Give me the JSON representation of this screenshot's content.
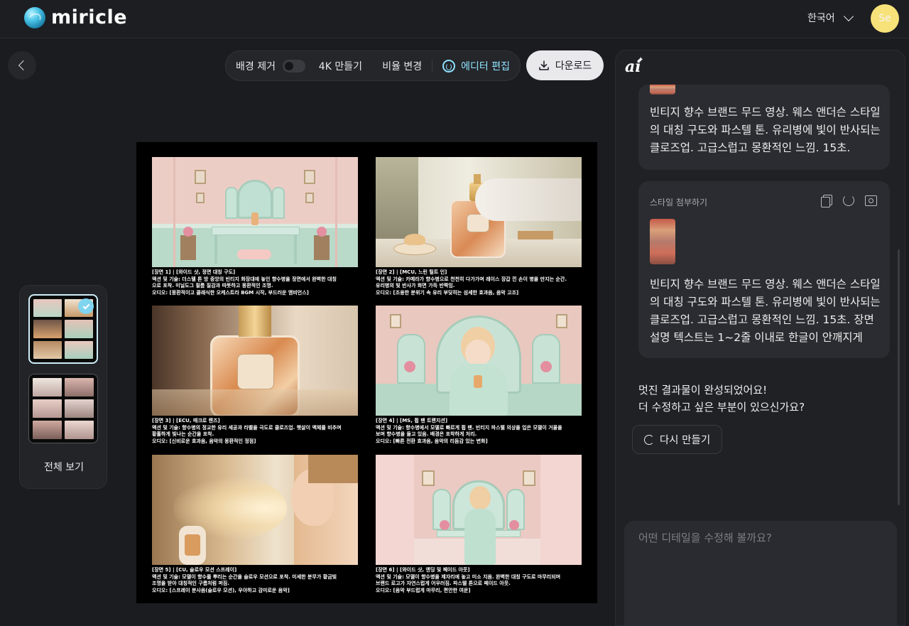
{
  "header": {
    "logo_text": "miricle",
    "language": "한국어",
    "avatar_initials": "Se"
  },
  "toolbar": {
    "remove_bg_label": "배경 제거",
    "remove_bg_on": false,
    "make_4k_label": "4K 만들기",
    "ratio_label": "비율 변경",
    "editor_label": "에디터 편집",
    "download_label": "다운로드"
  },
  "thumbnails": {
    "view_all_label": "전체 보기",
    "selected_index": 0
  },
  "storyboard": {
    "scenes": [
      {
        "lines": [
          "[장면 1] | [와이드 샷, 정면 대칭 구도]",
          "액션 및 기술: 더스텔 톤 방 중앙의 빈티지 화장대에 놓인 향수병을 정면에서 완벽한 대칭",
          "으로 포착. 미닐도그 필름 질감과 따뜻하고 몽환적인 조명.",
          "오디오: [몽환적이고 클래식한 오케스트라 BGM 시작, 부드러운 앰비언스]"
        ]
      },
      {
        "lines": [
          "[장면 2] | [MCU, 느린 틸트 인]",
          "액션 및 기술: 카메라가 향수병으로 천천히 다가가며 레이스 장갑 낀 손이 병을 만지는 순간.",
          "유리병의 빛 반사가 화면 가득 반짝임.",
          "오디오: [조용한 분위기 속 유리 부딪히는 섬세한 효과음, 음악 고조]"
        ]
      },
      {
        "lines": [
          "[장면 3] | [ECU, 매크로 렌즈]",
          "액션 및 기술: 향수병의 정교한 유리 세공과 라벨을 극도로 클로즈업. 햇살이 액체를 비추며",
          "황홀하게 빛나는 순간을 포착.",
          "오디오: [신비로운 효과음, 음악의 몽환적인 정점]"
        ]
      },
      {
        "lines": [
          "[장면 4] | [MS, 휩 팬 트랜지션]",
          "액션 및 기술: 향수병에서 모델로 빠르게 휩 팬. 빈티지 파스텔 의상을 입은 모델이 거울을",
          "보며 향수병을 들고 있음. 배경은 포착하게 처리.",
          "오디오: [빠른 전환 효과음, 음악의 리듬감 있는 변화]"
        ]
      },
      {
        "lines": [
          "[장면 5] | [CU, 슬로우 모션 스프레이]",
          "액션 및 기술: 모델이 향수를 뿌리는 순간을 슬로우 모션으로 포착. 미세한 분무가 황금빛",
          "조명을 받아 대칭적인 구름처럼 퍼짐.",
          "오디오: [스프레이 분사음(슬로우 모션), 우아하고 감미로운 음악]"
        ]
      },
      {
        "lines": [
          "[장면 6] | [와이드 샷, 엔딩 및 페이드 아웃]",
          "액션 및 기술: 모델이 향수병을 제자리에 놓고 미소 지음. 완벽한 대칭 구도로 마무리되며",
          "브랜드 로고가 자연스럽게 어우러짐. 파스텔 톤으로 페이드 아웃.",
          "오디오: [음악 부드럽게 마무리, 편안한 여운]"
        ]
      }
    ]
  },
  "chat": {
    "messages": [
      {
        "text": "빈티지 향수 브랜드 무드 영상. 웨스 앤더슨 스타일의 대칭 구도와 파스텔 톤. 유리병에 빛이 반사되는 클로즈업. 고급스럽고 몽환적인 느낌. 15초."
      },
      {
        "attachment_label": "스타일 첨부하기",
        "text": "빈티지 향수 브랜드 무드 영상. 웨스 앤더슨 스타일의 대칭 구도와 파스텔 톤. 유리병에 빛이 반사되는 클로즈업. 고급스럽고 몽환적인 느낌. 15초. 장면 설명 텍스트는 1~2줄 이내로 한글이 안깨지게"
      }
    ],
    "reply_line1": "멋진 결과물이 완성되었어요!",
    "reply_line2": "더 수정하고 싶은 부분이 있으신가요?",
    "retry_label": "다시 만들기",
    "input_placeholder": "어떤 디테일을 수정해 볼까요?"
  },
  "colors": {
    "background": "#1b1c1f",
    "accent": "#8fe3ff",
    "avatar": "#f7e27a"
  }
}
